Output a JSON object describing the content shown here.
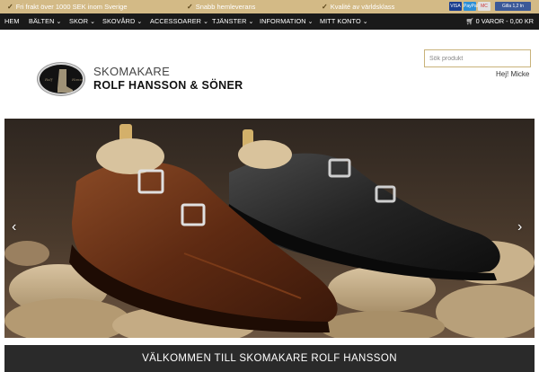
{
  "topbar": {
    "usps": [
      "Fri frakt över 1000 SEK inom Sverige",
      "Snabb hemleverans",
      "Kvalité av världsklass"
    ],
    "payment_badges": [
      "VISA",
      "PayPal",
      "MC",
      "Gilla 1,2 tn"
    ]
  },
  "nav": {
    "items": [
      {
        "label": "HEM",
        "dropdown": false
      },
      {
        "label": "BÄLTEN",
        "dropdown": true
      },
      {
        "label": "SKOR",
        "dropdown": true
      },
      {
        "label": "SKOVÅRD",
        "dropdown": true
      },
      {
        "label": "ACCESSOARER",
        "dropdown": true
      },
      {
        "label": "TJÄNSTER",
        "dropdown": true
      },
      {
        "label": "INFORMATION",
        "dropdown": true
      },
      {
        "label": "MITT KONTO",
        "dropdown": true
      }
    ],
    "cart": "0 VAROR - 0,00 KR"
  },
  "logo": {
    "line1": "SKOMAKARE",
    "line2": "ROLF HANSSON & SÖNER"
  },
  "search": {
    "placeholder": "Sök produkt",
    "value": ""
  },
  "greeting": "Hej! Micke",
  "hero": {
    "prev_arrow": "‹",
    "next_arrow": "›"
  },
  "welcome": "VÄLKOMMEN TILL SKOMAKARE ROLF HANSSON",
  "colors": {
    "topbar": "#d3ba86",
    "navbar": "#1a1a1a",
    "welcome_bar": "#2a2a2a",
    "accent": "#c9b27a"
  }
}
